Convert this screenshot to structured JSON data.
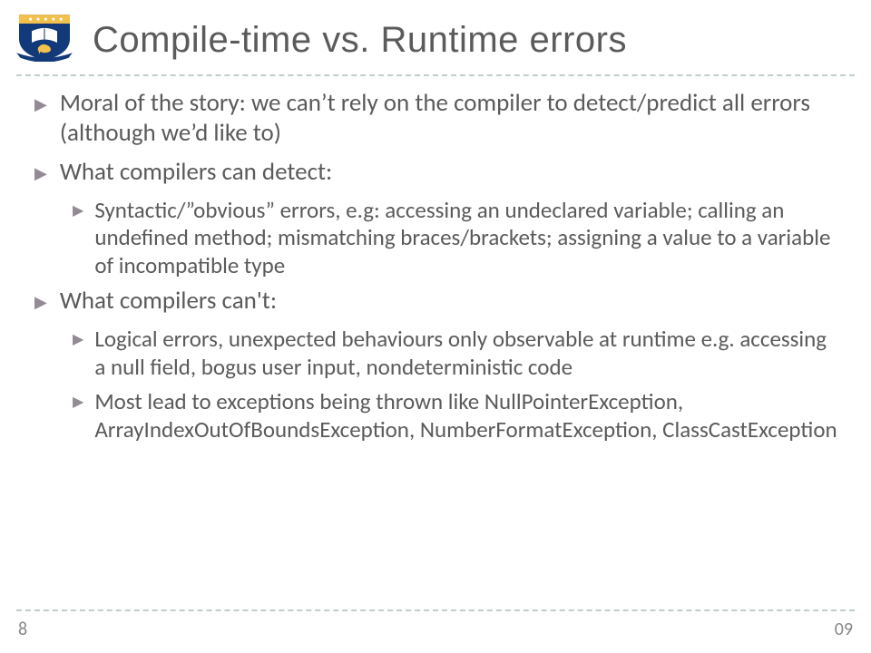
{
  "title": "Compile-time vs. Runtime errors",
  "bullets": [
    {
      "level": 1,
      "text": "Moral of the story: we can’t rely on the compiler to detect/predict all errors (although we’d like to)"
    },
    {
      "level": 1,
      "text": "What compilers can detect:"
    },
    {
      "level": 2,
      "text": "Syntactic/”obvious” errors, e.g: accessing an undeclared variable; calling an undefined method; mismatching braces/brackets; assigning a value to a variable of incompatible type"
    },
    {
      "level": 1,
      "text": "What compilers can't:"
    },
    {
      "level": 2,
      "text": "Logical errors, unexpected behaviours only observable at runtime e.g. accessing a null field, bogus user input, nondeterministic code"
    },
    {
      "level": 2,
      "text": "Most lead to exceptions being thrown like NullPointerException, ArrayIndexOutOfBoundsException, NumberFormatException, ClassCastException"
    }
  ],
  "footer": {
    "left": "8",
    "right": "09"
  },
  "colors": {
    "text": "#595959",
    "rule": "#8aa8a6",
    "bulletMark": "#948a96",
    "shieldBlue": "#123a7a",
    "shieldGold": "#f3c14b"
  }
}
